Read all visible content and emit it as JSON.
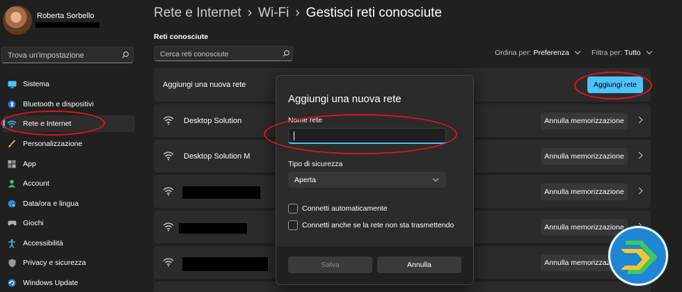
{
  "user": {
    "name": "Roberta Sorbello"
  },
  "sidebar": {
    "search_placeholder": "Trova un'impostazione",
    "items": [
      {
        "label": "Sistema",
        "icon": "monitor-icon",
        "color": "#4cc2ff"
      },
      {
        "label": "Bluetooth e dispositivi",
        "icon": "bluetooth-icon",
        "color": "#4cc2ff"
      },
      {
        "label": "Rete e Internet",
        "icon": "network-icon",
        "color": "#4cc2ff",
        "active": true
      },
      {
        "label": "Personalizzazione",
        "icon": "brush-icon",
        "color": "#f7b264"
      },
      {
        "label": "App",
        "icon": "apps-icon",
        "color": "#b0b0b0"
      },
      {
        "label": "Account",
        "icon": "account-icon",
        "color": "#33c481"
      },
      {
        "label": "Data/ora e lingua",
        "icon": "globe-clock-icon",
        "color": "#4cc2ff"
      },
      {
        "label": "Giochi",
        "icon": "gamepad-icon",
        "color": "#b0b0b0"
      },
      {
        "label": "Accessibilità",
        "icon": "accessibility-icon",
        "color": "#4cc2ff"
      },
      {
        "label": "Privacy e sicurezza",
        "icon": "shield-icon",
        "color": "#b0b0b0"
      },
      {
        "label": "Windows Update",
        "icon": "update-icon",
        "color": "#4cc2ff"
      }
    ]
  },
  "breadcrumb": {
    "first": "Rete e Internet",
    "second": "Wi-Fi",
    "current": "Gestisci reti conosciute",
    "separator": "›"
  },
  "known_networks": {
    "section_label": "Reti conosciute",
    "search_placeholder": "Cerca reti conosciute",
    "sort_label": "Ordina per:",
    "sort_value": "Preferenza",
    "filter_label": "Filtra per:",
    "filter_value": "Tutto",
    "add_row_label": "Aggiungi una nuova rete",
    "add_button_label": "Aggiungi rete",
    "forget_label": "Annulla memorizzazione",
    "networks": [
      {
        "name": "Desktop Solution"
      },
      {
        "name": "Desktop Solution M"
      },
      {
        "name": ""
      },
      {
        "name": ""
      },
      {
        "name": ""
      }
    ]
  },
  "dialog": {
    "title": "Aggiungi una nuova rete",
    "network_name_label": "Nome rete",
    "network_name_value": "",
    "security_label": "Tipo di sicurezza",
    "security_value": "Aperta",
    "auto_connect_label": "Connetti automaticamente",
    "auto_connect_checked": false,
    "hidden_connect_label": "Connetti anche se la rete non sta trasmettendo",
    "hidden_connect_checked": false,
    "save_label": "Salva",
    "cancel_label": "Annulla"
  },
  "colors": {
    "accent": "#4cc2ff",
    "annotation": "#e0141e",
    "background": "#202020"
  }
}
